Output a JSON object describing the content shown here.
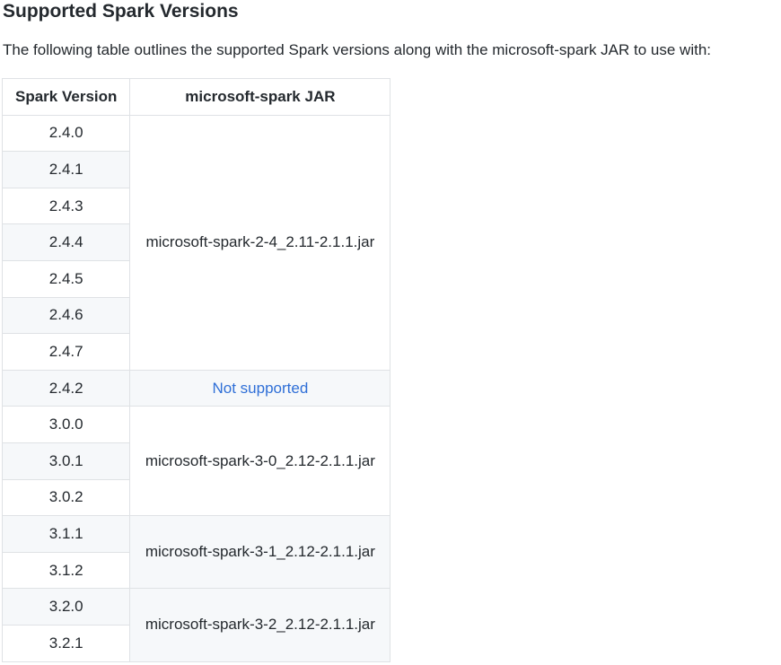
{
  "section": {
    "title": "Supported Spark Versions",
    "intro": "The following table outlines the supported Spark versions along with the microsoft-spark JAR to use with:"
  },
  "table": {
    "headers": {
      "version": "Spark Version",
      "jar": "microsoft-spark JAR"
    },
    "rows": [
      "2.4.0",
      "2.4.1",
      "2.4.3",
      "2.4.4",
      "2.4.5",
      "2.4.6",
      "2.4.7",
      "2.4.2",
      "3.0.0",
      "3.0.1",
      "3.0.2",
      "3.1.1",
      "3.1.2",
      "3.2.0",
      "3.2.1"
    ],
    "jars": [
      "microsoft-spark-2-4_2.11-2.1.1.jar",
      "Not supported",
      "microsoft-spark-3-0_2.12-2.1.1.jar",
      "microsoft-spark-3-1_2.12-2.1.1.jar",
      "microsoft-spark-3-2_2.12-2.1.1.jar"
    ]
  },
  "colors": {
    "text": "#24292e",
    "border": "#dfe2e5",
    "stripe": "#f6f8fa",
    "link": "#2f6fd7"
  }
}
